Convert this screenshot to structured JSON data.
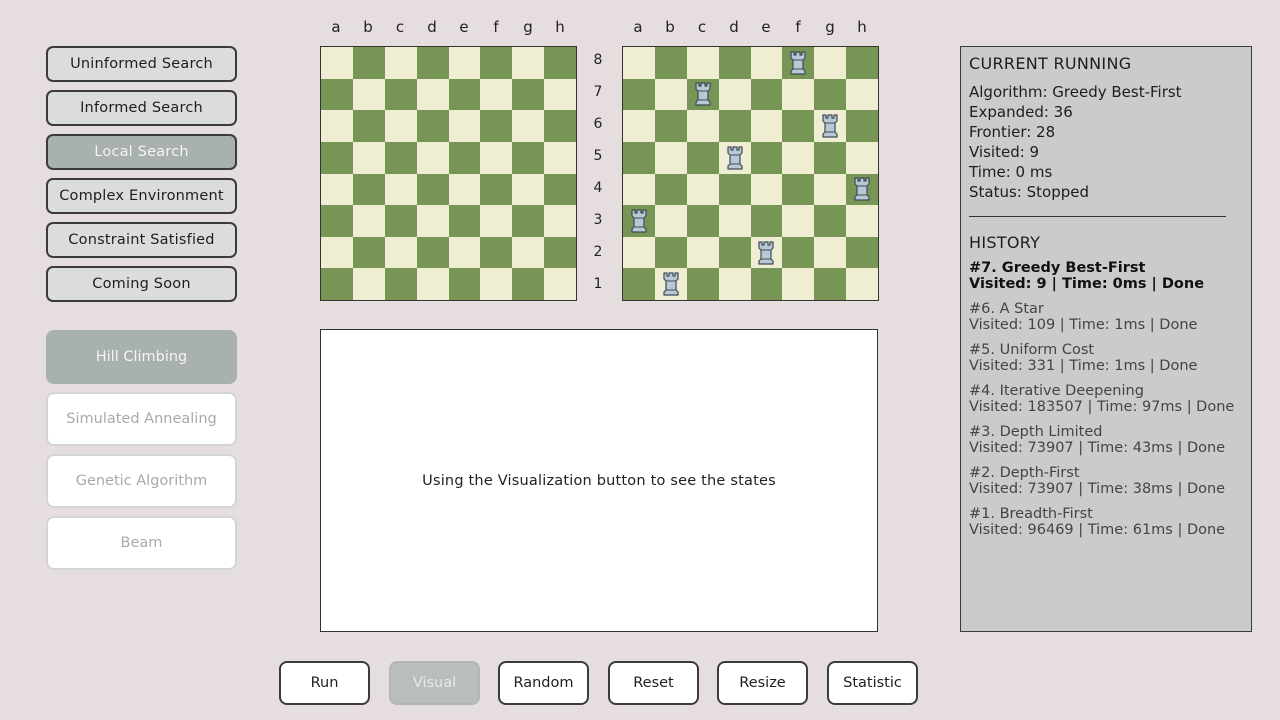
{
  "categories": [
    {
      "label": "Uninformed Search",
      "active": false
    },
    {
      "label": "Informed Search",
      "active": false
    },
    {
      "label": "Local Search",
      "active": true
    },
    {
      "label": "Complex Environment",
      "active": false
    },
    {
      "label": "Constraint Satisfied",
      "active": false
    },
    {
      "label": "Coming Soon",
      "active": false
    }
  ],
  "algorithms": [
    {
      "label": "Hill Climbing",
      "active": true
    },
    {
      "label": "Simulated Annealing",
      "active": false
    },
    {
      "label": "Genetic Algorithm",
      "active": false
    },
    {
      "label": "Beam",
      "active": false
    }
  ],
  "boards": {
    "files": [
      "a",
      "b",
      "c",
      "d",
      "e",
      "f",
      "g",
      "h"
    ],
    "ranks": [
      "8",
      "7",
      "6",
      "5",
      "4",
      "3",
      "2",
      "1"
    ],
    "colors": {
      "light": "#efeed2",
      "dark": "#779655"
    },
    "piece": "rook-icon",
    "left_pieces": [],
    "right_pieces": [
      "f8",
      "c7",
      "g6",
      "d5",
      "h4",
      "a3",
      "e2",
      "b1"
    ]
  },
  "visualization": {
    "message": "Using the Visualization button to see the states"
  },
  "current_running": {
    "title": "CURRENT RUNNING",
    "algorithm": "Algorithm: Greedy Best-First",
    "expanded": "Expanded: 36",
    "frontier": "Frontier: 28",
    "visited": "Visited: 9",
    "time": "Time: 0 ms",
    "status": "Status: Stopped"
  },
  "history": {
    "title": "HISTORY",
    "entries": [
      {
        "name": "#7. Greedy Best-First",
        "detail": "Visited: 9 | Time: 0ms | Done"
      },
      {
        "name": "#6. A Star",
        "detail": "Visited: 109 | Time: 1ms | Done"
      },
      {
        "name": "#5. Uniform Cost",
        "detail": "Visited: 331 | Time: 1ms | Done"
      },
      {
        "name": "#4. Iterative Deepening",
        "detail": "Visited: 183507 | Time: 97ms | Done"
      },
      {
        "name": "#3. Depth Limited",
        "detail": "Visited: 73907 | Time: 43ms | Done"
      },
      {
        "name": "#2. Depth-First",
        "detail": "Visited: 73907 | Time: 38ms | Done"
      },
      {
        "name": "#1. Breadth-First",
        "detail": "Visited: 96469 | Time: 61ms | Done"
      }
    ]
  },
  "bottom_buttons": [
    {
      "label": "Run",
      "disabled": false
    },
    {
      "label": "Visual",
      "disabled": true
    },
    {
      "label": "Random",
      "disabled": false
    },
    {
      "label": "Reset",
      "disabled": false
    },
    {
      "label": "Resize",
      "disabled": false
    },
    {
      "label": "Statistic",
      "disabled": false
    }
  ]
}
